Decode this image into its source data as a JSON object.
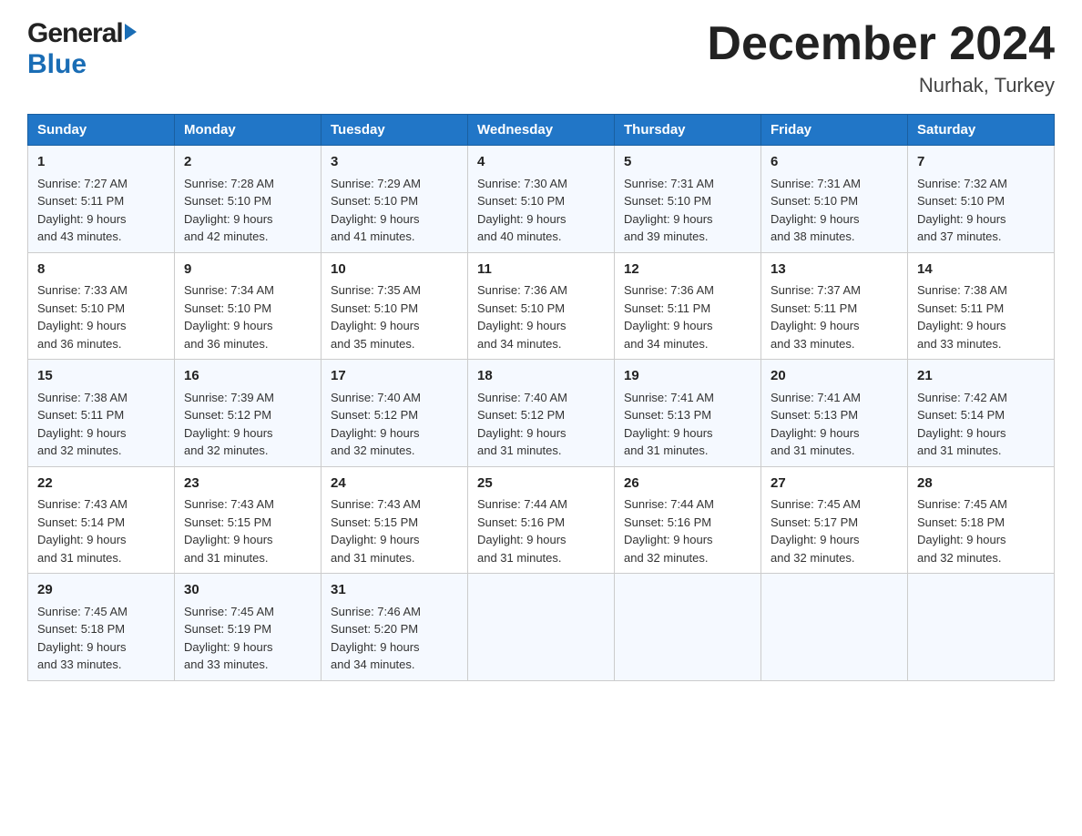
{
  "header": {
    "logo_general": "General",
    "logo_blue": "Blue",
    "month_title": "December 2024",
    "location": "Nurhak, Turkey"
  },
  "weekdays": [
    "Sunday",
    "Monday",
    "Tuesday",
    "Wednesday",
    "Thursday",
    "Friday",
    "Saturday"
  ],
  "weeks": [
    [
      {
        "day": "1",
        "sunrise": "7:27 AM",
        "sunset": "5:11 PM",
        "daylight": "9 hours and 43 minutes."
      },
      {
        "day": "2",
        "sunrise": "7:28 AM",
        "sunset": "5:10 PM",
        "daylight": "9 hours and 42 minutes."
      },
      {
        "day": "3",
        "sunrise": "7:29 AM",
        "sunset": "5:10 PM",
        "daylight": "9 hours and 41 minutes."
      },
      {
        "day": "4",
        "sunrise": "7:30 AM",
        "sunset": "5:10 PM",
        "daylight": "9 hours and 40 minutes."
      },
      {
        "day": "5",
        "sunrise": "7:31 AM",
        "sunset": "5:10 PM",
        "daylight": "9 hours and 39 minutes."
      },
      {
        "day": "6",
        "sunrise": "7:31 AM",
        "sunset": "5:10 PM",
        "daylight": "9 hours and 38 minutes."
      },
      {
        "day": "7",
        "sunrise": "7:32 AM",
        "sunset": "5:10 PM",
        "daylight": "9 hours and 37 minutes."
      }
    ],
    [
      {
        "day": "8",
        "sunrise": "7:33 AM",
        "sunset": "5:10 PM",
        "daylight": "9 hours and 36 minutes."
      },
      {
        "day": "9",
        "sunrise": "7:34 AM",
        "sunset": "5:10 PM",
        "daylight": "9 hours and 36 minutes."
      },
      {
        "day": "10",
        "sunrise": "7:35 AM",
        "sunset": "5:10 PM",
        "daylight": "9 hours and 35 minutes."
      },
      {
        "day": "11",
        "sunrise": "7:36 AM",
        "sunset": "5:10 PM",
        "daylight": "9 hours and 34 minutes."
      },
      {
        "day": "12",
        "sunrise": "7:36 AM",
        "sunset": "5:11 PM",
        "daylight": "9 hours and 34 minutes."
      },
      {
        "day": "13",
        "sunrise": "7:37 AM",
        "sunset": "5:11 PM",
        "daylight": "9 hours and 33 minutes."
      },
      {
        "day": "14",
        "sunrise": "7:38 AM",
        "sunset": "5:11 PM",
        "daylight": "9 hours and 33 minutes."
      }
    ],
    [
      {
        "day": "15",
        "sunrise": "7:38 AM",
        "sunset": "5:11 PM",
        "daylight": "9 hours and 32 minutes."
      },
      {
        "day": "16",
        "sunrise": "7:39 AM",
        "sunset": "5:12 PM",
        "daylight": "9 hours and 32 minutes."
      },
      {
        "day": "17",
        "sunrise": "7:40 AM",
        "sunset": "5:12 PM",
        "daylight": "9 hours and 32 minutes."
      },
      {
        "day": "18",
        "sunrise": "7:40 AM",
        "sunset": "5:12 PM",
        "daylight": "9 hours and 31 minutes."
      },
      {
        "day": "19",
        "sunrise": "7:41 AM",
        "sunset": "5:13 PM",
        "daylight": "9 hours and 31 minutes."
      },
      {
        "day": "20",
        "sunrise": "7:41 AM",
        "sunset": "5:13 PM",
        "daylight": "9 hours and 31 minutes."
      },
      {
        "day": "21",
        "sunrise": "7:42 AM",
        "sunset": "5:14 PM",
        "daylight": "9 hours and 31 minutes."
      }
    ],
    [
      {
        "day": "22",
        "sunrise": "7:43 AM",
        "sunset": "5:14 PM",
        "daylight": "9 hours and 31 minutes."
      },
      {
        "day": "23",
        "sunrise": "7:43 AM",
        "sunset": "5:15 PM",
        "daylight": "9 hours and 31 minutes."
      },
      {
        "day": "24",
        "sunrise": "7:43 AM",
        "sunset": "5:15 PM",
        "daylight": "9 hours and 31 minutes."
      },
      {
        "day": "25",
        "sunrise": "7:44 AM",
        "sunset": "5:16 PM",
        "daylight": "9 hours and 31 minutes."
      },
      {
        "day": "26",
        "sunrise": "7:44 AM",
        "sunset": "5:16 PM",
        "daylight": "9 hours and 32 minutes."
      },
      {
        "day": "27",
        "sunrise": "7:45 AM",
        "sunset": "5:17 PM",
        "daylight": "9 hours and 32 minutes."
      },
      {
        "day": "28",
        "sunrise": "7:45 AM",
        "sunset": "5:18 PM",
        "daylight": "9 hours and 32 minutes."
      }
    ],
    [
      {
        "day": "29",
        "sunrise": "7:45 AM",
        "sunset": "5:18 PM",
        "daylight": "9 hours and 33 minutes."
      },
      {
        "day": "30",
        "sunrise": "7:45 AM",
        "sunset": "5:19 PM",
        "daylight": "9 hours and 33 minutes."
      },
      {
        "day": "31",
        "sunrise": "7:46 AM",
        "sunset": "5:20 PM",
        "daylight": "9 hours and 34 minutes."
      },
      null,
      null,
      null,
      null
    ]
  ],
  "labels": {
    "sunrise": "Sunrise:",
    "sunset": "Sunset:",
    "daylight": "Daylight:"
  }
}
